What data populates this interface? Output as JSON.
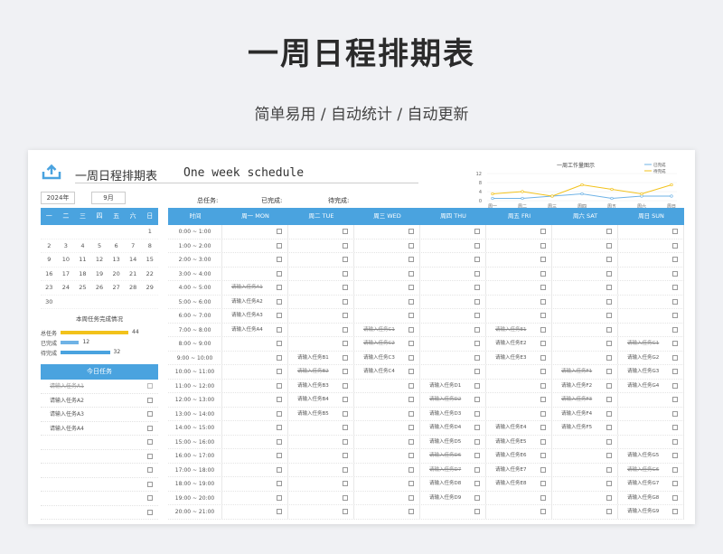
{
  "hero": {
    "title": "一周日程排期表",
    "subtitle": "简单易用  /  自动统计  /  自动更新"
  },
  "header": {
    "title_cn": "一周日程排期表",
    "title_en": "One week schedule",
    "year": "2024年",
    "month": "9月"
  },
  "stats": {
    "total_label": "总任务:",
    "done_label": "已完成:",
    "pending_label": "待完成:"
  },
  "calendar": {
    "weekdays": [
      "一",
      "二",
      "三",
      "四",
      "五",
      "六",
      "日"
    ],
    "weeks": [
      [
        "",
        "",
        "",
        "",
        "",
        "",
        "1"
      ],
      [
        "2",
        "3",
        "4",
        "5",
        "6",
        "7",
        "8"
      ],
      [
        "9",
        "10",
        "11",
        "12",
        "13",
        "14",
        "15"
      ],
      [
        "16",
        "17",
        "18",
        "19",
        "20",
        "21",
        "22"
      ],
      [
        "23",
        "24",
        "25",
        "26",
        "27",
        "28",
        "29"
      ],
      [
        "30",
        "",
        "",
        "",
        "",
        "",
        ""
      ]
    ]
  },
  "weekly_summary": {
    "title": "本周任务完成情况",
    "rows": [
      {
        "label": "总任务",
        "value": 44,
        "color": "#f2c21b"
      },
      {
        "label": "已完成",
        "value": 12,
        "color": "#6fb3e6"
      },
      {
        "label": "待完成",
        "value": 32,
        "color": "#4aa3df"
      }
    ],
    "max": 44
  },
  "today": {
    "title": "今日任务",
    "items": [
      {
        "text": "请输入任务A1",
        "done": true
      },
      {
        "text": "请输入任务A2",
        "done": false
      },
      {
        "text": "请输入任务A3",
        "done": false
      },
      {
        "text": "请输入任务A4",
        "done": false
      },
      {
        "text": "",
        "done": false
      },
      {
        "text": "",
        "done": false
      },
      {
        "text": "",
        "done": false
      },
      {
        "text": "",
        "done": false
      },
      {
        "text": "",
        "done": false
      },
      {
        "text": "",
        "done": false
      }
    ]
  },
  "schedule": {
    "headers": [
      "时间",
      "周一  MON",
      "周二  TUE",
      "周三  WED",
      "周四  THU",
      "周五  FRI",
      "周六  SAT",
      "周日  SUN"
    ],
    "times": [
      "0:00 ~ 1:00",
      "1:00 ~ 2:00",
      "2:00 ~ 3:00",
      "3:00 ~ 4:00",
      "4:00 ~ 5:00",
      "5:00 ~ 6:00",
      "6:00 ~ 7:00",
      "7:00 ~ 8:00",
      "8:00 ~ 9:00",
      "9:00 ~ 10:00",
      "10:00 ~ 11:00",
      "11:00 ~ 12:00",
      "12:00 ~ 13:00",
      "13:00 ~ 14:00",
      "14:00 ~ 15:00",
      "15:00 ~ 16:00",
      "16:00 ~ 17:00",
      "17:00 ~ 18:00",
      "18:00 ~ 19:00",
      "19:00 ~ 20:00",
      "20:00 ~ 21:00"
    ],
    "cells": [
      [
        [
          "",
          0
        ],
        [
          "",
          0
        ],
        [
          "",
          0
        ],
        [
          "",
          0
        ],
        [
          "",
          0
        ],
        [
          "",
          0
        ],
        [
          "",
          0
        ]
      ],
      [
        [
          "",
          0
        ],
        [
          "",
          0
        ],
        [
          "",
          0
        ],
        [
          "",
          0
        ],
        [
          "",
          0
        ],
        [
          "",
          0
        ],
        [
          "",
          0
        ]
      ],
      [
        [
          "",
          0
        ],
        [
          "",
          0
        ],
        [
          "",
          0
        ],
        [
          "",
          0
        ],
        [
          "",
          0
        ],
        [
          "",
          0
        ],
        [
          "",
          0
        ]
      ],
      [
        [
          "",
          0
        ],
        [
          "",
          0
        ],
        [
          "",
          0
        ],
        [
          "",
          0
        ],
        [
          "",
          0
        ],
        [
          "",
          0
        ],
        [
          "",
          0
        ]
      ],
      [
        [
          "请输入任务A1",
          1
        ],
        [
          "",
          0
        ],
        [
          "",
          0
        ],
        [
          "",
          0
        ],
        [
          "",
          0
        ],
        [
          "",
          0
        ],
        [
          "",
          0
        ]
      ],
      [
        [
          "请输入任务A2",
          0
        ],
        [
          "",
          0
        ],
        [
          "",
          0
        ],
        [
          "",
          0
        ],
        [
          "",
          0
        ],
        [
          "",
          0
        ],
        [
          "",
          0
        ]
      ],
      [
        [
          "请输入任务A3",
          0
        ],
        [
          "",
          0
        ],
        [
          "",
          0
        ],
        [
          "",
          0
        ],
        [
          "",
          0
        ],
        [
          "",
          0
        ],
        [
          "",
          0
        ]
      ],
      [
        [
          "请输入任务A4",
          0
        ],
        [
          "",
          0
        ],
        [
          "请输入任务C1",
          1
        ],
        [
          "",
          0
        ],
        [
          "请输入任务E1",
          1
        ],
        [
          "",
          0
        ],
        [
          "",
          0
        ]
      ],
      [
        [
          "",
          0
        ],
        [
          "",
          0
        ],
        [
          "请输入任务C2",
          1
        ],
        [
          "",
          0
        ],
        [
          "请输入任务E2",
          0
        ],
        [
          "",
          0
        ],
        [
          "请输入任务G1",
          1
        ]
      ],
      [
        [
          "",
          0
        ],
        [
          "请输入任务B1",
          0
        ],
        [
          "请输入任务C3",
          0
        ],
        [
          "",
          0
        ],
        [
          "请输入任务E3",
          0
        ],
        [
          "",
          0
        ],
        [
          "请输入任务G2",
          0
        ]
      ],
      [
        [
          "",
          0
        ],
        [
          "请输入任务B2",
          1
        ],
        [
          "请输入任务C4",
          0
        ],
        [
          "",
          0
        ],
        [
          "",
          0
        ],
        [
          "请输入任务F1",
          1
        ],
        [
          "请输入任务G3",
          0
        ]
      ],
      [
        [
          "",
          0
        ],
        [
          "请输入任务B3",
          0
        ],
        [
          "",
          0
        ],
        [
          "请输入任务D1",
          0
        ],
        [
          "",
          0
        ],
        [
          "请输入任务F2",
          0
        ],
        [
          "请输入任务G4",
          0
        ]
      ],
      [
        [
          "",
          0
        ],
        [
          "请输入任务B4",
          0
        ],
        [
          "",
          0
        ],
        [
          "请输入任务D2",
          1
        ],
        [
          "",
          0
        ],
        [
          "请输入任务F3",
          1
        ],
        [
          "",
          0
        ]
      ],
      [
        [
          "",
          0
        ],
        [
          "请输入任务B5",
          0
        ],
        [
          "",
          0
        ],
        [
          "请输入任务D3",
          0
        ],
        [
          "",
          0
        ],
        [
          "请输入任务F4",
          0
        ],
        [
          "",
          0
        ]
      ],
      [
        [
          "",
          0
        ],
        [
          "",
          0
        ],
        [
          "",
          0
        ],
        [
          "请输入任务D4",
          0
        ],
        [
          "请输入任务E4",
          0
        ],
        [
          "请输入任务F5",
          0
        ],
        [
          "",
          0
        ]
      ],
      [
        [
          "",
          0
        ],
        [
          "",
          0
        ],
        [
          "",
          0
        ],
        [
          "请输入任务D5",
          0
        ],
        [
          "请输入任务E5",
          0
        ],
        [
          "",
          0
        ],
        [
          "",
          0
        ]
      ],
      [
        [
          "",
          0
        ],
        [
          "",
          0
        ],
        [
          "",
          0
        ],
        [
          "请输入任务D6",
          1
        ],
        [
          "请输入任务E6",
          0
        ],
        [
          "",
          0
        ],
        [
          "请输入任务G5",
          0
        ]
      ],
      [
        [
          "",
          0
        ],
        [
          "",
          0
        ],
        [
          "",
          0
        ],
        [
          "请输入任务D7",
          1
        ],
        [
          "请输入任务E7",
          0
        ],
        [
          "",
          0
        ],
        [
          "请输入任务G6",
          1
        ]
      ],
      [
        [
          "",
          0
        ],
        [
          "",
          0
        ],
        [
          "",
          0
        ],
        [
          "请输入任务D8",
          0
        ],
        [
          "请输入任务E8",
          0
        ],
        [
          "",
          0
        ],
        [
          "请输入任务G7",
          0
        ]
      ],
      [
        [
          "",
          0
        ],
        [
          "",
          0
        ],
        [
          "",
          0
        ],
        [
          "请输入任务D9",
          0
        ],
        [
          "",
          0
        ],
        [
          "",
          0
        ],
        [
          "请输入任务G8",
          0
        ]
      ],
      [
        [
          "",
          0
        ],
        [
          "",
          0
        ],
        [
          "",
          0
        ],
        [
          "",
          0
        ],
        [
          "",
          0
        ],
        [
          "",
          0
        ],
        [
          "请输入任务G9",
          0
        ]
      ]
    ]
  },
  "chart_data": {
    "type": "line",
    "title": "一周工作量图示",
    "categories": [
      "周一",
      "周二",
      "周三",
      "周四",
      "周五",
      "周六",
      "周日"
    ],
    "ylim": [
      0,
      12
    ],
    "yticks": [
      0,
      4,
      8,
      12
    ],
    "series": [
      {
        "name": "已完成",
        "values": [
          1,
          1,
          2,
          3,
          1,
          2,
          2
        ],
        "color": "#6fb3e6"
      },
      {
        "name": "待完成",
        "values": [
          3,
          4,
          2,
          7,
          5,
          3,
          7
        ],
        "color": "#f2c21b"
      }
    ],
    "legend": "top-right"
  }
}
